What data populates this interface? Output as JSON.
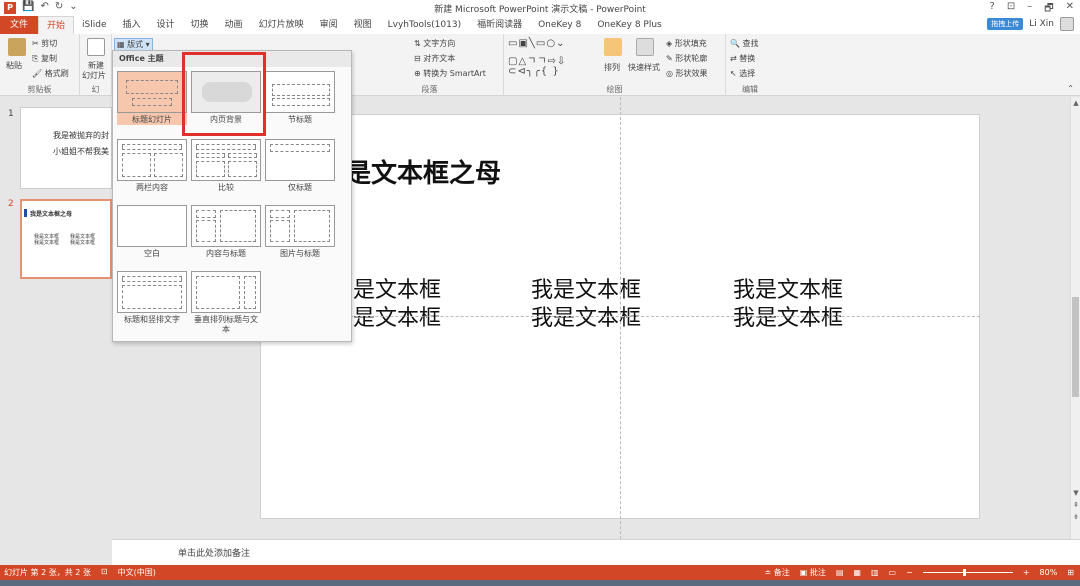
{
  "window": {
    "title": "新建 Microsoft PowerPoint 演示文稿 - PowerPoint",
    "controls": [
      "?",
      "⊡",
      "–",
      "🗗",
      "✕"
    ]
  },
  "tabs": [
    {
      "label": "文件",
      "kind": "file"
    },
    {
      "label": "开始",
      "kind": "active"
    },
    {
      "label": "iSlide"
    },
    {
      "label": "插入"
    },
    {
      "label": "设计"
    },
    {
      "label": "切换"
    },
    {
      "label": "动画"
    },
    {
      "label": "幻灯片放映"
    },
    {
      "label": "审阅"
    },
    {
      "label": "视图"
    },
    {
      "label": "LvyhTools(1013)"
    },
    {
      "label": "福昕阅读器"
    },
    {
      "label": "OneKey 8"
    },
    {
      "label": "OneKey 8 Plus"
    }
  ],
  "user": {
    "upload": "拖拽上传",
    "name": "Li Xin"
  },
  "ribbon": {
    "clipboard": {
      "paste": "粘贴",
      "cut": "剪切",
      "copy": "复制",
      "format_painter": "格式刷",
      "label": "剪贴板"
    },
    "slides": {
      "new_slide": "新建",
      "new_slide2": "幻灯片",
      "layout": "版式",
      "label": "幻"
    },
    "paragraph": {
      "text_dir": "文字方向",
      "align_text": "对齐文本",
      "smartart": "转换为 SmartArt",
      "label": "段落"
    },
    "drawing": {
      "arrange": "排列",
      "quick_styles": "快速样式",
      "shape_fill": "形状填充",
      "shape_outline": "形状轮廓",
      "shape_effects": "形状效果",
      "label": "绘图"
    },
    "editing": {
      "find": "查找",
      "replace": "替换",
      "select": "选择",
      "label": "编辑"
    }
  },
  "dropdown": {
    "header": "Office 主题",
    "layouts": [
      {
        "name": "标题幻灯片",
        "selected": true
      },
      {
        "name": "内页背景",
        "selected": false
      },
      {
        "name": "节标题",
        "selected": false
      },
      {
        "name": "两栏内容",
        "selected": false
      },
      {
        "name": "比较",
        "selected": false
      },
      {
        "name": "仅标题",
        "selected": false
      },
      {
        "name": "空白",
        "selected": false
      },
      {
        "name": "内容与标题",
        "selected": false
      },
      {
        "name": "图片与标题",
        "selected": false
      },
      {
        "name": "标题和竖排文字",
        "selected": false
      },
      {
        "name": "垂直排列标题与文本",
        "selected": false
      }
    ]
  },
  "thumbnails": [
    {
      "num": "1",
      "line1": "我是被抛弃的封",
      "line2": "小姐姐不帮我美"
    },
    {
      "num": "2",
      "title": "我是文本框之母",
      "text": "我是文本框"
    }
  ],
  "slide": {
    "title": "是文本框之母",
    "col1": [
      "是文本框",
      "是文本框"
    ],
    "col2": [
      "我是文本框",
      "我是文本框"
    ],
    "col3": [
      "我是文本框",
      "我是文本框"
    ]
  },
  "notes": {
    "placeholder": "单击此处添加备注"
  },
  "status": {
    "slide_info": "幻灯片 第 2 张，共 2 张",
    "language": "中文(中国)",
    "notes": "备注",
    "comments": "批注",
    "zoom": "80%"
  }
}
